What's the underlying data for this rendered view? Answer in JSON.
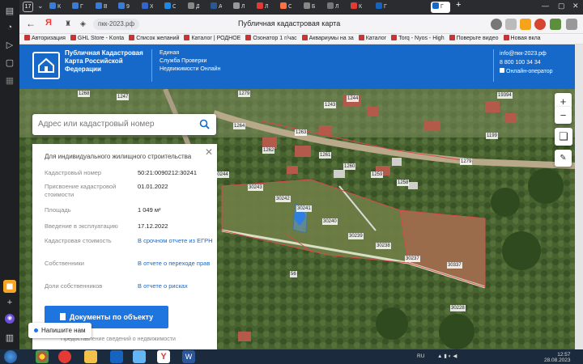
{
  "browser": {
    "tab_count": "17",
    "tabs": [
      {
        "label": "К",
        "color": "#3a7bd5"
      },
      {
        "label": "Г",
        "color": "#3a7bd5"
      },
      {
        "label": "В",
        "color": "#3a7bd5"
      },
      {
        "label": "9",
        "color": "#3a7bd5"
      },
      {
        "label": "Х",
        "color": "#3366cc"
      },
      {
        "label": "C",
        "color": "#1e88e5"
      },
      {
        "label": "Д",
        "color": "#888"
      },
      {
        "label": "A",
        "color": "#2b5797"
      },
      {
        "label": "Л",
        "color": "#999"
      },
      {
        "label": "Л",
        "color": "#e53935"
      },
      {
        "label": "C",
        "color": "#ff7043"
      },
      {
        "label": "Б",
        "color": "#888"
      },
      {
        "label": "Л",
        "color": "#777"
      },
      {
        "label": "К",
        "color": "#e53935"
      },
      {
        "label": "Г",
        "color": "#1565c0"
      }
    ],
    "url": "пкк-2023.рф",
    "page_title": "Публичная кадастровая карта",
    "bookmarks": [
      "Авторизация",
      "GHL Store - Konta",
      "Список желаний",
      "Каталог | РОДНОЕ",
      "Озонатор 1 г/час",
      "Аквариумы на за",
      "Каталог",
      "Torq - Nyos - High",
      "Поверьте видео",
      "Новая вкла"
    ]
  },
  "site": {
    "brand": "Публичная Кадастровая Карта Российской Федерации",
    "service": [
      "Единая",
      "Служба Проверки",
      "Недвижимости Онлайн"
    ],
    "email": "info@пкк-2023.рф",
    "phone": "8 800 100 34 34",
    "operator": "Онлайн-оператор"
  },
  "search": {
    "placeholder": "Адрес или кадастровый номер"
  },
  "card": {
    "title": "Для индивидуального жилищного строительства",
    "rows": [
      {
        "label": "Кадастровый номер",
        "value": "50:21:0090212:30241"
      },
      {
        "label": "Присвоение кадастровой стоимости",
        "value": "01.01.2022"
      },
      {
        "label": "Площадь",
        "value": "1 049 м²"
      },
      {
        "label": "Введение в эксплуатацию",
        "value": "17.12.2022"
      },
      {
        "label": "Кадастровая стоимость",
        "value": "В срочном отчете из ЕГРН"
      },
      {
        "label": "Собственники",
        "value": "В отчете о переходе прав"
      },
      {
        "label": "Доли собственников",
        "value": "В отчете о рисках"
      }
    ],
    "doc_button": "Документы по объекту",
    "footnote": "Предоставление сведений о недвижимости"
  },
  "chat": {
    "label": "Напишите нам"
  },
  "map": {
    "parcel_labels": [
      "1268",
      "1247",
      "1279",
      "1243",
      "1244",
      "19394",
      "1264",
      "1262",
      "1263",
      "1261",
      "1260",
      "1259",
      "1258",
      "1279",
      "1199",
      "30243",
      "30242",
      "30241",
      "30240",
      "30239",
      "30238",
      "30237",
      "30337",
      "30228",
      "30224",
      "56",
      "30244"
    ]
  },
  "taskbar": {
    "lang": "RU",
    "time": "12:57",
    "date": "28.08.2023"
  }
}
